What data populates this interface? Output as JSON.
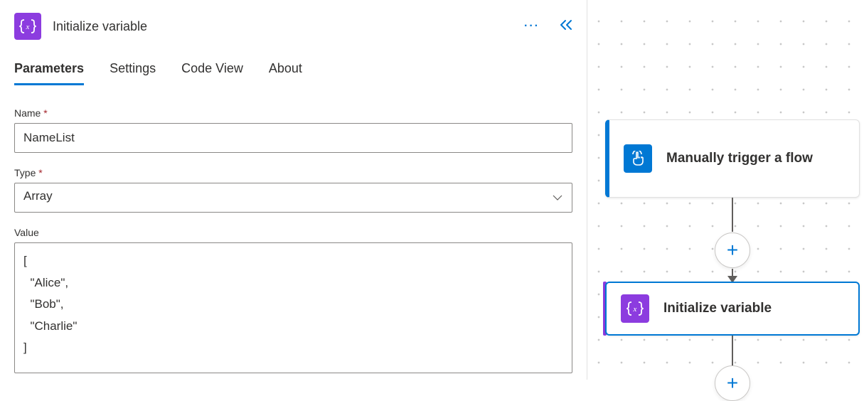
{
  "header": {
    "title": "Initialize variable"
  },
  "tabs": [
    {
      "label": "Parameters",
      "active": true
    },
    {
      "label": "Settings",
      "active": false
    },
    {
      "label": "Code View",
      "active": false
    },
    {
      "label": "About",
      "active": false
    }
  ],
  "form": {
    "name_label": "Name",
    "name_value": "NameList",
    "type_label": "Type",
    "type_value": "Array",
    "value_label": "Value",
    "value_value": "[\n  \"Alice\",\n  \"Bob\",\n  \"Charlie\"\n]"
  },
  "flow": {
    "trigger_title": "Manually trigger a flow",
    "action_title": "Initialize variable"
  }
}
